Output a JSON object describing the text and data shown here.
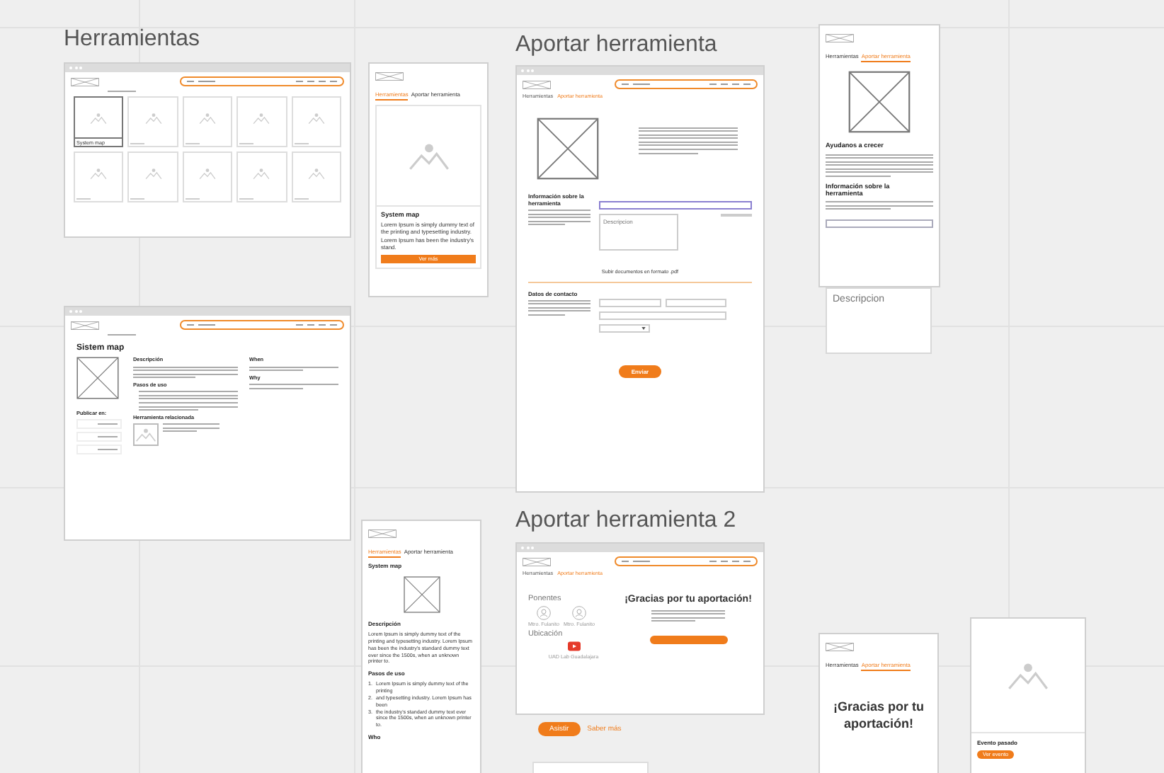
{
  "herramientas": {
    "title": "Herramientas",
    "desktop": {
      "tiles": [
        {
          "selected": true,
          "label": "System map"
        },
        {
          "selected": false
        },
        {
          "selected": false
        },
        {
          "selected": false
        },
        {
          "selected": false
        },
        {
          "selected": false
        },
        {
          "selected": false
        },
        {
          "selected": false
        },
        {
          "selected": false
        },
        {
          "selected": false
        }
      ]
    },
    "mobile": {
      "tabs": [
        {
          "label": "Herramientas",
          "selected": true
        },
        {
          "label": "Aportar herramienta",
          "selected": false
        }
      ],
      "card": {
        "title": "System map",
        "text": "Lorem Ipsum is simply dummy text of the printing and typesetting industry. Lorem Ipsum has been the industry's stand.",
        "button": "Ver más"
      }
    },
    "detail": {
      "heading": "Sistem map",
      "tags_title": "Publicar en:",
      "description_title": "Descripción",
      "steps_title": "Pasos de uso",
      "related_title": "Herramienta relacionada",
      "side": [
        {
          "title": "When"
        },
        {
          "title": "Why"
        }
      ]
    },
    "detail_mobile": {
      "tabs": [
        {
          "label": "Herramientas",
          "selected": true
        },
        {
          "label": "Aportar herramienta",
          "selected": false
        }
      ],
      "heading": "System map",
      "description_title": "Descripción",
      "description": "Lorem Ipsum is simply dummy text of the printing and typesetting industry. Lorem Ipsum has been the industry's standard dummy text ever since the 1500s, when an unknown printer to.",
      "steps_title": "Pasos de uso",
      "steps": [
        {
          "number": "1.",
          "text": "Lorem Ipsum is simply dummy text of the printing"
        },
        {
          "number": "2.",
          "text": "and typesetting industry. Lorem Ipsum has been"
        },
        {
          "number": "3.",
          "text": "the industry's standard dummy text ever since the 1500s, when an unknown printer to."
        }
      ],
      "next_title": "Who"
    }
  },
  "aportar": {
    "title": "Aportar herramienta",
    "desktop": {
      "breadcrumb": [
        {
          "label": "Herramientas",
          "selected": false
        },
        {
          "label": "Aportar herramienta",
          "selected": true
        }
      ],
      "info_title": "Información sobre la herramienta",
      "description_placeholder": "Descripcion",
      "upload_note": "Subir documentos en formato .pdf",
      "contact_title": "Datos de contacto",
      "submit": "Enviar"
    },
    "mobile": {
      "tabs": [
        {
          "label": "Herramientas",
          "selected": false
        },
        {
          "label": "Aportar herramienta",
          "selected": true
        }
      ],
      "heading": "Ayudanos a crecer",
      "info_title": "Información sobre la herramienta",
      "description_placeholder": "Descripcion"
    }
  },
  "aportar2": {
    "title": "Aportar herramienta 2",
    "desktop": {
      "breadcrumb": [
        {
          "label": "Herramientas",
          "selected": false
        },
        {
          "label": "Aportar herramienta",
          "selected": true
        }
      ],
      "speakers_title": "Ponentes",
      "speakers": [
        "Mtro. Fulanito",
        "Mtro. Fulanito"
      ],
      "location_title": "Ubicación",
      "location": "UAD Lab Guadalajara",
      "thanks": "¡Gracias por tu aportación!"
    },
    "actions": {
      "primary": "Asistir",
      "link": "Saber más"
    },
    "mobile": {
      "tabs": [
        {
          "label": "Herramientas",
          "selected": false
        },
        {
          "label": "Aportar herramienta",
          "selected": true
        }
      ],
      "thanks": "¡Gracias por tu aportación!"
    },
    "event_card": {
      "title": "Evento pasado",
      "button": "Ver evento"
    }
  }
}
